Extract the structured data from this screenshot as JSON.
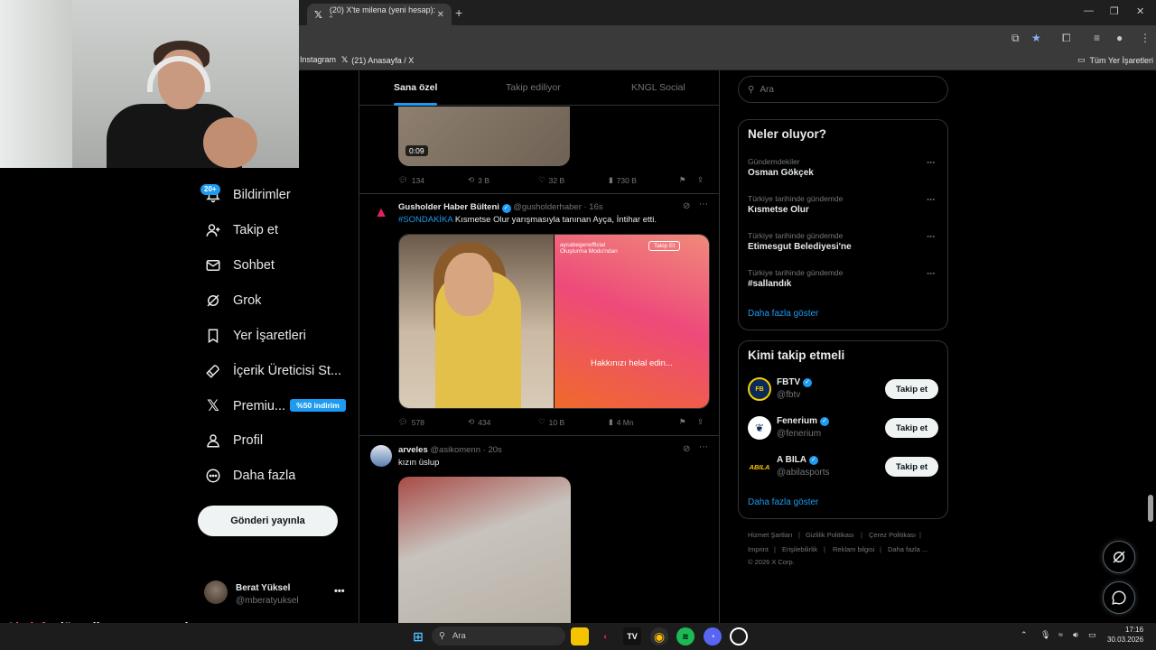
{
  "browser": {
    "active_tab_title": "(20) X'te milena (yeni hesap): \"",
    "new_tab_symbol": "+",
    "bookmarks": [
      "Instagram",
      "(21) Anasayfa / X"
    ],
    "bookmarks_folder": "Tüm Yer İşaretleri"
  },
  "nav": {
    "notif_badge": "20+",
    "items": [
      {
        "label": "Bildirimler",
        "icon": "bell-icon"
      },
      {
        "label": "Takip et",
        "icon": "person-plus-icon"
      },
      {
        "label": "Sohbet",
        "icon": "mail-icon"
      },
      {
        "label": "Grok",
        "icon": "grok-icon"
      },
      {
        "label": "Yer İşaretleri",
        "icon": "bookmark-icon"
      },
      {
        "label": "İçerik Üreticisi St...",
        "icon": "rocket-icon"
      },
      {
        "label": "Premiu...",
        "icon": "x-logo-icon"
      },
      {
        "label": "Profil",
        "icon": "person-icon"
      },
      {
        "label": "Daha fazla",
        "icon": "more-circle-icon"
      }
    ],
    "premium_badge": "%50 indirim",
    "post_button": "Gönderi yayınla",
    "account": {
      "name": "Berat Yüksel",
      "handle": "@mberatyuksel",
      "more": "•••"
    }
  },
  "timeline": {
    "tabs": [
      "Sana özel",
      "Takip ediliyor",
      "KNGL Social"
    ],
    "post0": {
      "duration": "0:09",
      "actions": {
        "reply": "134",
        "repost": "3 B",
        "like": "32 B",
        "views": "730 B"
      }
    },
    "post1": {
      "author": "Gusholder Haber Bülteni",
      "handle": "@gusholderhaber",
      "time": "· 16s",
      "hashtag": "#SONDAKİKA",
      "text": " Kısmetse Olur yarışmasıyla tanınan Ayça, İntihar etti.",
      "media_right_user": "aycabegenofficial",
      "media_right_sub": "Oluşturma Modu'ndan",
      "media_right_follow": "Takip Et",
      "media_right_message": "Hakkınızı helal edin...",
      "actions": {
        "reply": "578",
        "repost": "434",
        "like": "10 B",
        "views": "4 Mn"
      }
    },
    "post2": {
      "author": "arveles",
      "handle": "@asikomenn",
      "time": "· 20s",
      "text": "kızın üslup"
    }
  },
  "right": {
    "search_placeholder": "Ara",
    "trends_title": "Neler oluyor?",
    "trends": [
      {
        "context": "Gündemdekiler",
        "name": "Osman Gökçek"
      },
      {
        "context": "Türkiye tarihinde gündemde",
        "name": "Kısmetse Olur"
      },
      {
        "context": "Türkiye tarihinde gündemde",
        "name": "Etimesgut Belediyesi'ne"
      },
      {
        "context": "Türkiye tarihinde gündemde",
        "name": "#sallandık"
      }
    ],
    "show_more": "Daha fazla göster",
    "who_title": "Kimi takip etmeli",
    "who": [
      {
        "name": "FBTV",
        "handle": "@fbtv",
        "button": "Takip et"
      },
      {
        "name": "Fenerium",
        "handle": "@fenerium",
        "button": "Takip et"
      },
      {
        "name": "A BILA",
        "handle": "@abilasports",
        "button": "Takip et"
      }
    ],
    "who_show_more": "Daha fazla göster",
    "footer": [
      "Hizmet Şartları",
      "Gizlilik Politikası",
      "Çerez Politikası",
      "Imprint",
      "Erişilebilirlik",
      "Reklam bilgisi",
      "Daha fazla ...",
      "© 2026 X Corp."
    ]
  },
  "chat": {
    "user": "Ajadef",
    "message": " : düzenli yayıncı mıyız hocam"
  },
  "taskbar": {
    "search": "Ara",
    "time": "17:16",
    "date": "30.03.2026"
  },
  "colors": {
    "accent": "#1d9bf0",
    "background": "#000000",
    "border": "#2f3336",
    "muted": "#71767b"
  }
}
